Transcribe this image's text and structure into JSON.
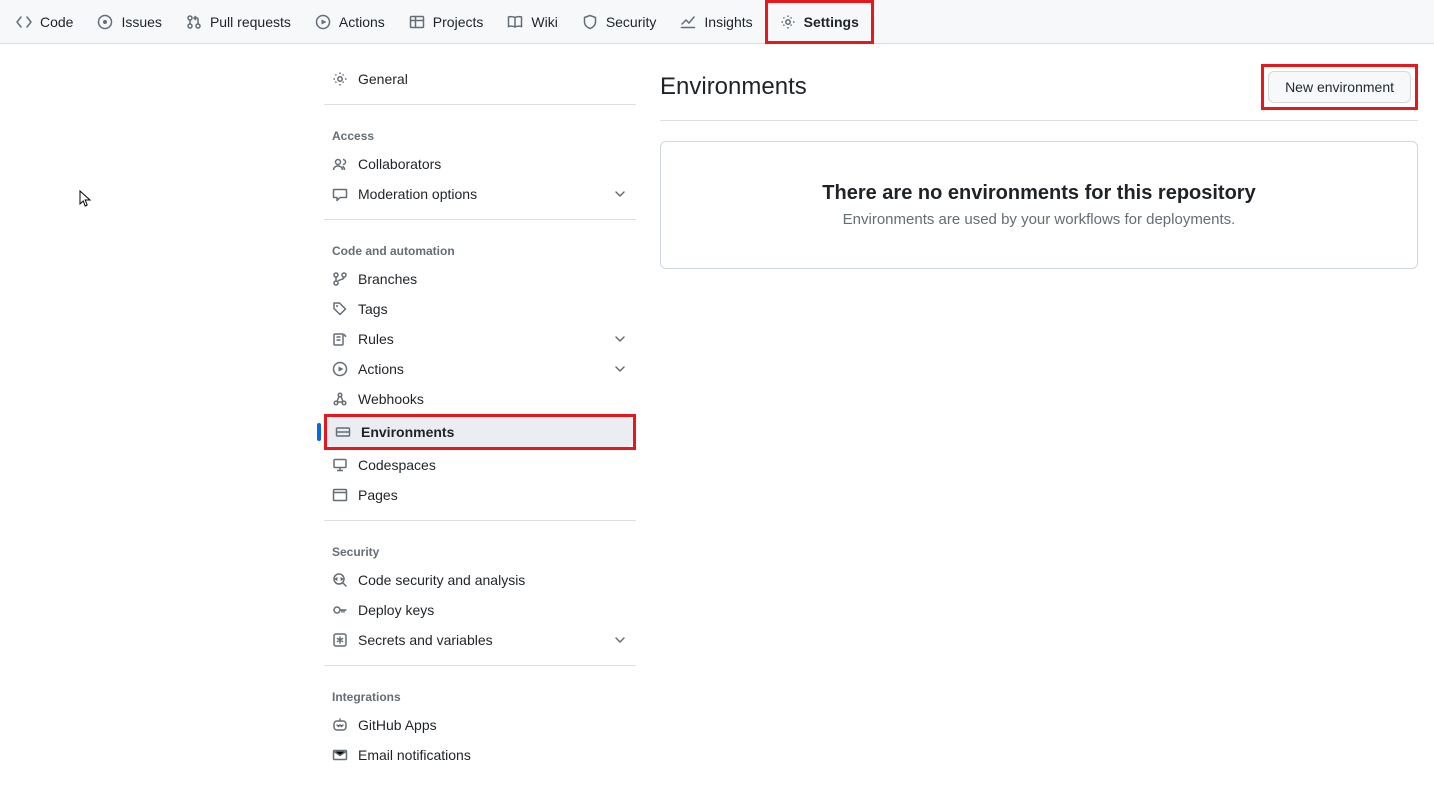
{
  "repoNav": [
    {
      "key": "code",
      "label": "Code",
      "icon": "code"
    },
    {
      "key": "issues",
      "label": "Issues",
      "icon": "issue"
    },
    {
      "key": "pull",
      "label": "Pull requests",
      "icon": "pr"
    },
    {
      "key": "actions",
      "label": "Actions",
      "icon": "play"
    },
    {
      "key": "projects",
      "label": "Projects",
      "icon": "table"
    },
    {
      "key": "wiki",
      "label": "Wiki",
      "icon": "book"
    },
    {
      "key": "security",
      "label": "Security",
      "icon": "shield"
    },
    {
      "key": "insights",
      "label": "Insights",
      "icon": "graph"
    },
    {
      "key": "settings",
      "label": "Settings",
      "icon": "gear",
      "active": true,
      "highlight": true
    }
  ],
  "sidebar": {
    "general": {
      "label": "General",
      "icon": "gear"
    },
    "groups": [
      {
        "title": "Access",
        "items": [
          {
            "key": "collaborators",
            "label": "Collaborators",
            "icon": "people"
          },
          {
            "key": "moderation",
            "label": "Moderation options",
            "icon": "comment",
            "expandable": true
          }
        ]
      },
      {
        "title": "Code and automation",
        "items": [
          {
            "key": "branches",
            "label": "Branches",
            "icon": "branch"
          },
          {
            "key": "tags",
            "label": "Tags",
            "icon": "tag"
          },
          {
            "key": "rules",
            "label": "Rules",
            "icon": "rules",
            "expandable": true
          },
          {
            "key": "actions",
            "label": "Actions",
            "icon": "play",
            "expandable": true
          },
          {
            "key": "webhooks",
            "label": "Webhooks",
            "icon": "webhook"
          },
          {
            "key": "environments",
            "label": "Environments",
            "icon": "server",
            "selected": true,
            "highlight": true
          },
          {
            "key": "codespaces",
            "label": "Codespaces",
            "icon": "codespaces"
          },
          {
            "key": "pages",
            "label": "Pages",
            "icon": "browser"
          }
        ]
      },
      {
        "title": "Security",
        "items": [
          {
            "key": "codesec",
            "label": "Code security and analysis",
            "icon": "codescan"
          },
          {
            "key": "deploykeys",
            "label": "Deploy keys",
            "icon": "key"
          },
          {
            "key": "secrets",
            "label": "Secrets and variables",
            "icon": "asterisk",
            "expandable": true
          }
        ]
      },
      {
        "title": "Integrations",
        "items": [
          {
            "key": "ghapps",
            "label": "GitHub Apps",
            "icon": "hubot"
          },
          {
            "key": "email",
            "label": "Email notifications",
            "icon": "mail"
          }
        ]
      }
    ]
  },
  "main": {
    "title": "Environments",
    "newBtn": "New environment",
    "blankslate": {
      "heading": "There are no environments for this repository",
      "subtext": "Environments are used by your workflows for deployments."
    }
  }
}
